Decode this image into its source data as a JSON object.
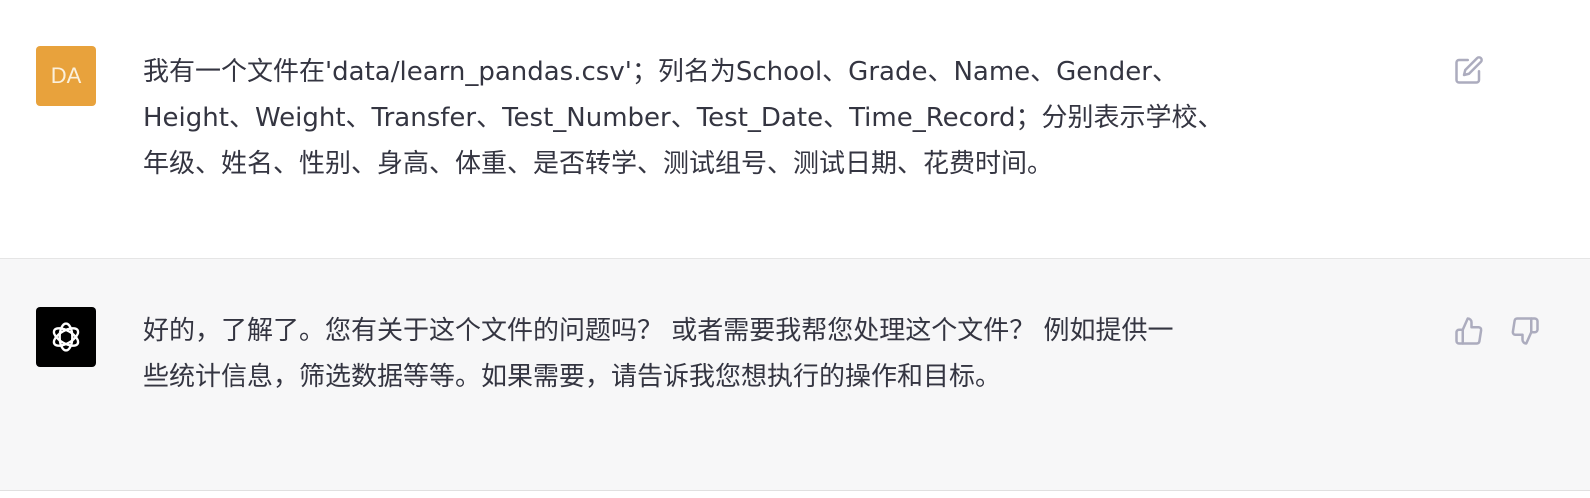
{
  "user_message": {
    "avatar_initials": "DA",
    "avatar_color": "#e8a23c",
    "lines": [
      "我有一个文件在'data/learn_pandas.csv'；列名为School、Grade、Name、Gender、",
      "Height、Weight、Transfer、Test_Number、Test_Date、Time_Record；分别表示学校、",
      "年级、姓名、性别、身高、体重、是否转学、测试组号、测试日期、花费时间。"
    ],
    "actions": [
      "edit-icon"
    ]
  },
  "assistant_message": {
    "avatar_icon": "openai-logo-icon",
    "lines": [
      "好的，了解了。您有关于这个文件的问题吗？ 或者需要我帮您处理这个文件？ 例如提供一",
      "些统计信息，筛选数据等等。如果需要，请告诉我您想执行的操作和目标。"
    ],
    "actions": [
      "thumbs-up-icon",
      "thumbs-down-icon"
    ]
  }
}
